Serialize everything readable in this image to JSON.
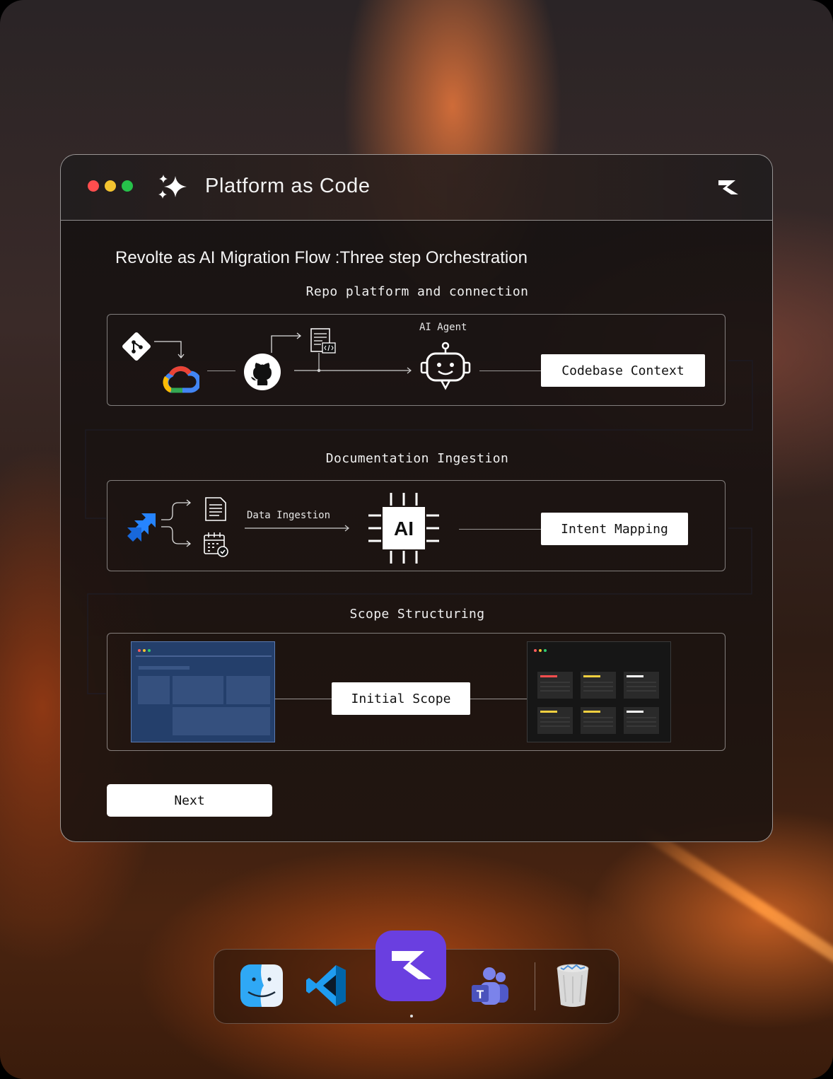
{
  "window": {
    "title": "Platform as Code",
    "heading": "Revolte as AI Migration Flow :Three step Orchestration"
  },
  "steps": {
    "repo": {
      "label": "Repo platform and connection",
      "agent_label": "AI Agent",
      "output": "Codebase Context"
    },
    "docs": {
      "label": "Documentation Ingestion",
      "ingestion_label": "Data Ingestion",
      "ai_text": "AI",
      "output": "Intent Mapping"
    },
    "scope": {
      "label": "Scope Structuring",
      "output": "Initial Scope"
    }
  },
  "next_button": "Next",
  "dock": {
    "items": [
      "finder-icon",
      "vscode-icon",
      "revolte-app-icon",
      "teams-icon",
      "trash-icon"
    ],
    "teams_letter": "T"
  },
  "colors": {
    "accent_blue": "#4a6fd0",
    "traffic_red": "#ff4e4e",
    "traffic_yellow": "#f4c430",
    "traffic_green": "#26c14a",
    "dock_app_purple": "#6a3fe0"
  }
}
